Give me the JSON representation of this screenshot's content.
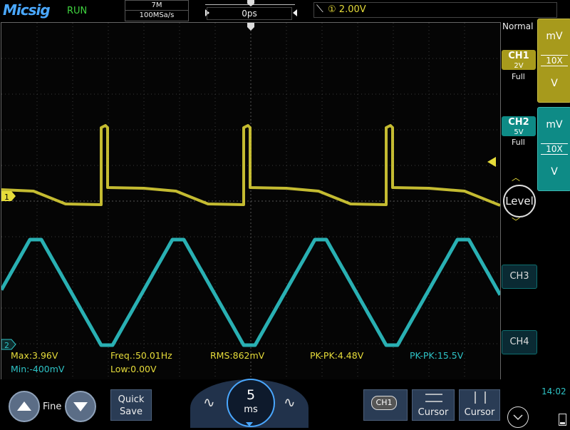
{
  "brand": "Micsig",
  "status": "RUN",
  "acquisition": {
    "memory": "7M",
    "sample_rate": "100MSa/s"
  },
  "time_offset": "0ps",
  "trigger": {
    "source_num": "①",
    "level": "2.00V"
  },
  "trigger_mode": "Normal",
  "channels": {
    "ch1": {
      "label": "CH1",
      "scale": "2V",
      "bandwidth": "Full",
      "unit_top": "mV",
      "probe": "10X",
      "unit_bottom": "V",
      "color": "#e6dc3a"
    },
    "ch2": {
      "label": "CH2",
      "scale": "5V",
      "bandwidth": "Full",
      "unit_top": "mV",
      "probe": "10X",
      "unit_bottom": "V",
      "color": "#2ec3c6"
    },
    "ch3": {
      "label": "CH3"
    },
    "ch4": {
      "label": "CH4"
    }
  },
  "level_button": "Level",
  "markers": {
    "ch1": "1",
    "ch2": "2"
  },
  "measurements": {
    "max": "Max:3.96V",
    "min": "Min:-400mV",
    "freq": "Freq.:50.01Hz",
    "low": "Low:0.00V",
    "rms": "RMS:862mV",
    "pkpk1": "PK-PK:4.48V",
    "pkpk2": "PK-PK:15.5V"
  },
  "bottom": {
    "fine": "Fine",
    "quick_save": [
      "Quick",
      "Save"
    ],
    "timebase_value": "5",
    "timebase_unit": "ms",
    "ch1_btn": "CH1",
    "cursor1": "Cursor",
    "cursor2": "Cursor"
  },
  "clock": "14:02"
}
